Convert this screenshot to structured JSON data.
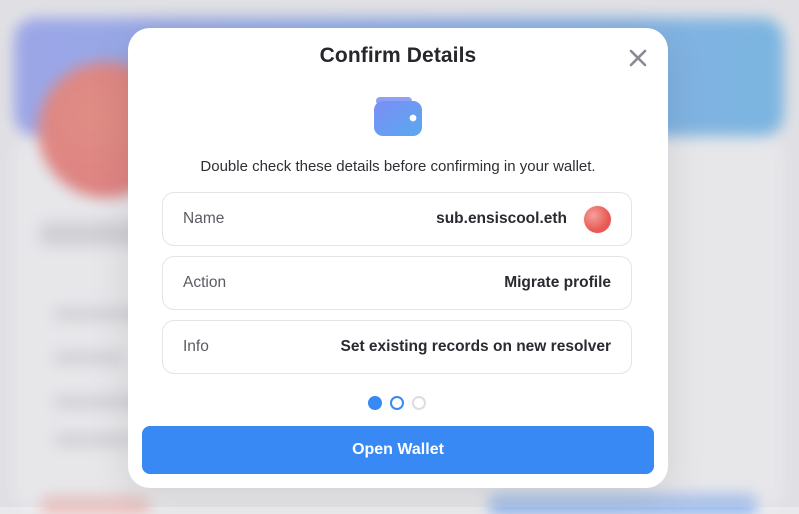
{
  "modal": {
    "title": "Confirm Details",
    "subtitle": "Double check these details before confirming in your wallet.",
    "close_icon": "close-icon",
    "wallet_icon": "wallet-icon",
    "rows": [
      {
        "label": "Name",
        "value": "sub.ensiscool.eth",
        "has_avatar": true
      },
      {
        "label": "Action",
        "value": "Migrate profile"
      },
      {
        "label": "Info",
        "value": "Set existing records on new resolver"
      }
    ],
    "steps": {
      "total": 3,
      "completed": 1,
      "current": 2
    },
    "primary_button": "Open Wallet"
  },
  "colors": {
    "accent": "#3889f4",
    "wallet_gradient_start": "#7b8ef5",
    "wallet_gradient_end": "#5aa8f0",
    "avatar_red": "#e85b54",
    "banner_gradient_start": "#7f8ff0",
    "banner_gradient_end": "#4ea7e6"
  }
}
